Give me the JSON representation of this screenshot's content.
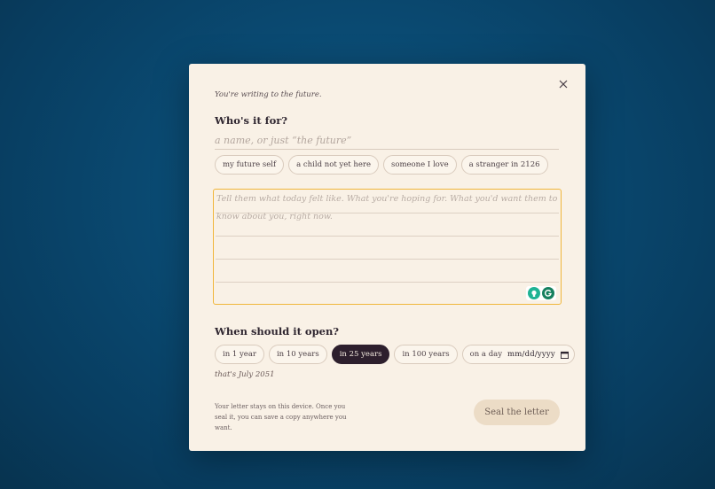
{
  "header": {
    "eyebrow": "You're writing to the future."
  },
  "recipient": {
    "heading": "Who's it for?",
    "placeholder": "a name, or just “the future”",
    "value": "",
    "suggestions": [
      "my future self",
      "a child not yet here",
      "someone I love",
      "a stranger in 2126"
    ]
  },
  "letter": {
    "placeholder": "Tell them what today felt like. What you're hoping for. What you'd want them to know about you, right now.",
    "value": ""
  },
  "open": {
    "heading": "When should it open?",
    "options": [
      {
        "label": "in 1 year",
        "selected": false
      },
      {
        "label": "in 10 years",
        "selected": false
      },
      {
        "label": "in 25 years",
        "selected": true
      },
      {
        "label": "in 100 years",
        "selected": false
      }
    ],
    "custom_label": "on a day",
    "date_placeholder": "mm/dd/yyyy",
    "hint": "that's July 2051"
  },
  "footer": {
    "note": "Your letter stays on this device. Once you seal it, you can save a copy anywhere you want.",
    "seal_label": "Seal the letter"
  },
  "icons": {
    "close": "close-icon",
    "calendar": "calendar-icon",
    "grammarly": "grammarly-icon",
    "suggestion": "lightbulb-icon"
  },
  "colors": {
    "accent_focus": "#f0b63a",
    "selected_chip": "#2d1f2d",
    "seal_button": "#ecdcc6"
  }
}
